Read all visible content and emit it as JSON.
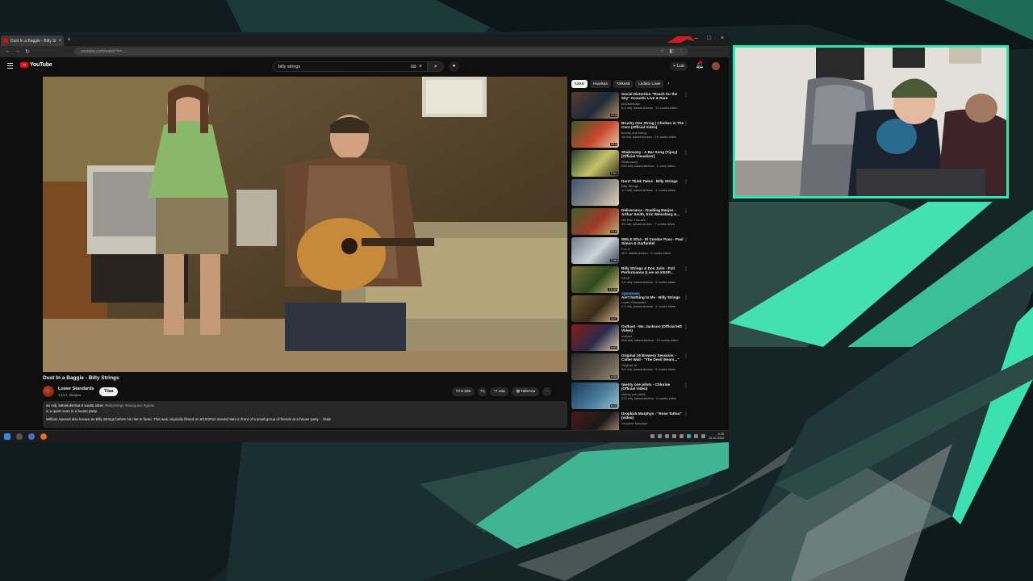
{
  "browser": {
    "tab_title": "Dust In a Baggie - Billy Strings - YouTube",
    "new_tab": "+",
    "url": "youtube.com/watch?v=..."
  },
  "youtube": {
    "logo_text": "YouTube",
    "search_query": "billy strings",
    "create_label": "+ Luo"
  },
  "video": {
    "title": "Dust In a Baggie - Billy Strings",
    "channel": "Lower Standards",
    "subscribers": "14,6 t. tilaajaa",
    "subscribe_label": "Tilaa",
    "likes": "6 285",
    "share_label": "Jaa",
    "save_label": "Tallenna",
    "more_label": "···",
    "description_stats": "an milj. katselukertaa 8 vuotta sitten",
    "description_tags": "#billystrings #bluegrass #guitar",
    "description_line2": "in a quiet room in a house party.",
    "description_line3": "William Apostol also known as Billy Strings before his rise to fame. This was originally filmed on 9/15/2012 around 8am in front of a small group of friends at a house party. ...lisää"
  },
  "sidebar": {
    "chips": [
      "Kaikki",
      "Hauskaa",
      "Tärkeää",
      "Ladattu Lowe"
    ],
    "recommendations": [
      {
        "title": "Social Distortion \"Reach for the Sky\" Acoustic Live & Rare",
        "channel": "pt32isbmusic",
        "stats": "6,4 milj. katselukertaa · 13 vuotta sitten",
        "duration": "4:13",
        "colors": [
          "#5a3b2a",
          "#1c2b3a",
          "#b88a5a"
        ]
      },
      {
        "title": "Brushy One String | Chicken in The Corn (Official Video)",
        "channel": "brushy one string",
        "stats": "18 milj. katselukertaa · 13 vuotta sitten",
        "duration": "3:14",
        "colors": [
          "#3a5a2a",
          "#c9472c",
          "#e8c9a0"
        ]
      },
      {
        "title": "Shaboozey - A Bar Song (Tipsy) [Official Visualizer]",
        "channel": "Shaboozey",
        "stats": "256 milj. katselukertaa · 1 vuosi sitten",
        "duration": "2:54",
        "colors": [
          "#233d2a",
          "#c5c36a",
          "#3c2a1c"
        ]
      },
      {
        "title": "Don't Think Twice · Billy Strings",
        "channel": "Billy Strings",
        "stats": "1,7 milj. katselukertaa · 4 vuotta sitten",
        "duration": "",
        "colors": [
          "#3d5470",
          "#8a8a8a",
          "#e2d2b0"
        ]
      },
      {
        "title": "Deliverance - Duelling Banjos - Arthur Smith, Eric Weissberg &...",
        "channel": "HD Film Tributes",
        "stats": "29 milj. katselukertaa · 7 vuotta sitten",
        "duration": "2:18",
        "colors": [
          "#41612c",
          "#9e3828",
          "#c2b070"
        ]
      },
      {
        "title": "WELS 2014 - El Condor Pasa - Paul Simon & Garfunkel",
        "channel": "Fox 3",
        "stats": "40 t. katselukertaa · 9 vuotta sitten",
        "duration": "2:36",
        "colors": [
          "#6e7c8a",
          "#ccd3d9",
          "#3a4450"
        ]
      },
      {
        "title": "Billy Strings & Don Julin - Full Performance (Live on KEXP...",
        "channel": "KEXP",
        "stats": "1,6 milj. katselukertaa · 5 vuotta sitten",
        "duration": "15:42",
        "badge": "Uusi tallenne",
        "colors": [
          "#7a6a3a",
          "#2d4a1c",
          "#d9c08a"
        ]
      },
      {
        "title": "Ain't Nothing to Me · Billy Strings",
        "channel": "Lower Standards",
        "stats": "1,3 milj. katselukertaa · 4 vuotta sitten",
        "duration": "3:27",
        "colors": [
          "#6b5636",
          "#3a2c1a",
          "#d7b78a"
        ]
      },
      {
        "title": "Outkast - Ms. Jackson (Official HD Video)",
        "channel": "outkast",
        "stats": "568 milj. katselukertaa · 15 vuotta sitten",
        "duration": "4:47",
        "colors": [
          "#8a1a1a",
          "#2a2a4a",
          "#e0d0b0"
        ]
      },
      {
        "title": "Original 16 Brewery Sessions - Colter Wall - \"The Devil Wears...\"",
        "channel": "Original 16",
        "stats": "3,6 milj. katselukertaa · 8 vuotta sitten",
        "duration": "4:35",
        "colors": [
          "#2a2a2a",
          "#5a5248",
          "#9a8c78"
        ]
      },
      {
        "title": "twenty one pilots - Chlorine (Official Video)",
        "channel": "twenty one pilots",
        "stats": "670 milj. katselukertaa · 6 vuotta sitten",
        "duration": "5:24",
        "colors": [
          "#1a3a5a",
          "#4a7a9a",
          "#9ac0d0"
        ]
      },
      {
        "title": "Dropkick Murphys - \"Rose Tattoo\" (video)",
        "channel": "Dropkick Murphys",
        "stats": "",
        "duration": "",
        "colors": [
          "#4a1a1a",
          "#1a1a1a",
          "#c0a080"
        ]
      }
    ]
  },
  "taskbar": {
    "time": "4.45",
    "date": "12.10.2024"
  },
  "accent_color": "#2ee6b0",
  "icons": [
    "hamburger-icon",
    "youtube-logo-icon",
    "search-icon",
    "mic-icon",
    "bell-icon",
    "like-icon",
    "dislike-icon",
    "share-icon",
    "save-icon",
    "windows-start-icon",
    "search-icon",
    "chrome-icon",
    "firefox-icon"
  ]
}
